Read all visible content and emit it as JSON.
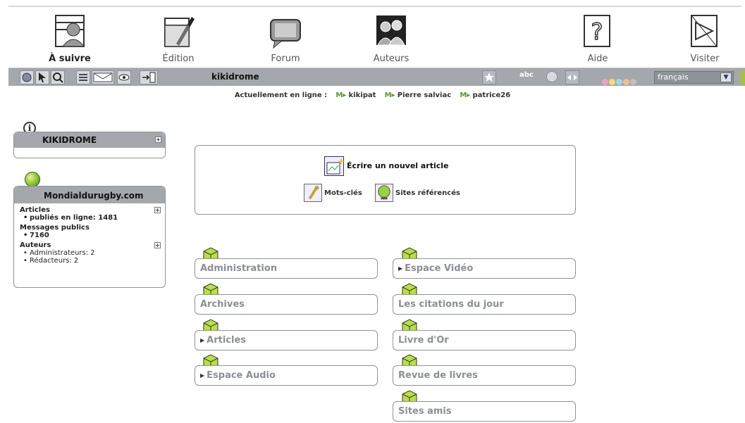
{
  "nav": {
    "items": [
      {
        "label": "À suivre",
        "icon": "person-icon",
        "active": true
      },
      {
        "label": "Édition",
        "icon": "pen-icon"
      },
      {
        "label": "Forum",
        "icon": "speech-bubble-icon"
      },
      {
        "label": "Auteurs",
        "icon": "group-icon"
      },
      {
        "label": "Aide",
        "icon": "help-icon"
      },
      {
        "label": "Visiter",
        "icon": "visit-icon"
      }
    ]
  },
  "toolbar": {
    "site_name": "kikidrome",
    "spell_label": "abc",
    "language": "français",
    "color_dots": [
      "#f0a0c0",
      "#f0e070",
      "#a0d8f0",
      "#f8c080",
      "#c0c0c0"
    ]
  },
  "online": {
    "label": "Actuellement en ligne :",
    "users": [
      "kikipat",
      "Pierre salviac",
      "patrice26"
    ]
  },
  "kikidrome_box": {
    "title": "KIKIDROME"
  },
  "stats_box": {
    "title": "Mondialdurugby.com",
    "articles_heading": "Articles",
    "articles_published": "publiés en ligne: 1481",
    "messages_heading": "Messages publics",
    "messages_count": "7160",
    "authors_heading": "Auteurs",
    "admins": "Administrateurs: 2",
    "editors": "Rédacteurs: 2"
  },
  "main": {
    "write_label": "Écrire un nouvel article",
    "keywords_label": "Mots-clés",
    "sites_label": "Sites référencés"
  },
  "rubrics": {
    "left": [
      {
        "label": "Administration",
        "arrow": false
      },
      {
        "label": "Archives",
        "arrow": false
      },
      {
        "label": "Articles",
        "arrow": true
      },
      {
        "label": "Espace Audio",
        "arrow": true
      }
    ],
    "right": [
      {
        "label": "Espace Vidéo",
        "arrow": true
      },
      {
        "label": "Les citations du jour",
        "arrow": false
      },
      {
        "label": "Livre d'Or",
        "arrow": false
      },
      {
        "label": "Revue de livres",
        "arrow": false
      },
      {
        "label": "Sites amis",
        "arrow": false
      }
    ]
  }
}
